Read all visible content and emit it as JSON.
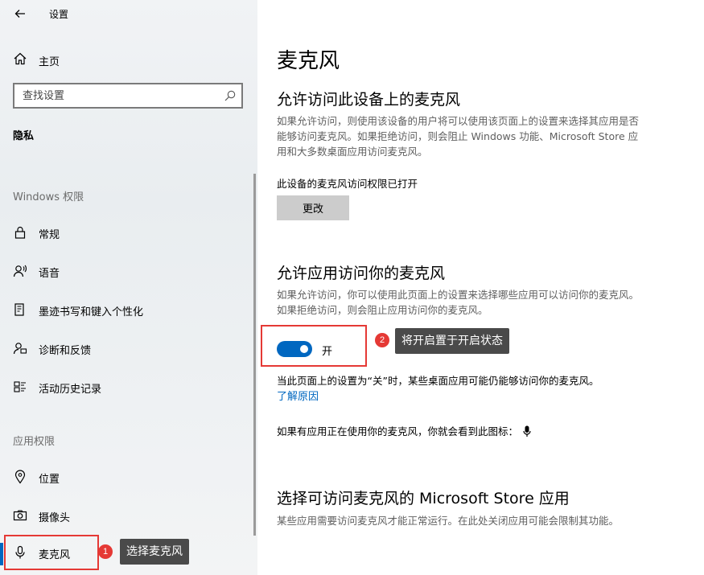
{
  "sidebar": {
    "title": "设置",
    "home_label": "主页",
    "search_placeholder": "查找设置",
    "section_title": "隐私",
    "group_windows": "Windows 权限",
    "windows_items": [
      {
        "label": "常规",
        "icon": "lock-icon"
      },
      {
        "label": "语音",
        "icon": "speech-icon"
      },
      {
        "label": "墨迹书写和键入个性化",
        "icon": "ink-typing-icon"
      },
      {
        "label": "诊断和反馈",
        "icon": "feedback-icon"
      },
      {
        "label": "活动历史记录",
        "icon": "activity-history-icon"
      }
    ],
    "group_app": "应用权限",
    "app_items": [
      {
        "label": "位置",
        "icon": "location-icon"
      },
      {
        "label": "摄像头",
        "icon": "camera-icon"
      },
      {
        "label": "麦克风",
        "icon": "microphone-icon",
        "active": true
      }
    ]
  },
  "annotations": {
    "step1_number": "1",
    "step1_text": "选择麦克风",
    "step2_number": "2",
    "step2_text": "将开启置于开启状态",
    "highlight_color": "#e53935"
  },
  "main": {
    "page_title": "麦克风",
    "device_section": {
      "heading": "允许访问此设备上的麦克风",
      "description": "如果允许访问，则使用该设备的用户将可以使用该页面上的设置来选择其应用是否能够访问麦克风。如果拒绝访问，则会阻止 Windows 功能、Microsoft Store 应用和大多数桌面应用访问麦克风。",
      "status": "此设备的麦克风访问权限已打开",
      "change_button": "更改"
    },
    "app_section": {
      "heading": "允许应用访问你的麦克风",
      "description": "如果允许访问，你可以使用此页面上的设置来选择哪些应用可以访问你的麦克风。如果拒绝访问，则会阻止应用访问你的麦克风。",
      "toggle_state": "开",
      "toggle_on": true,
      "note": "当此页面上的设置为“关”时，某些桌面应用可能仍能够访问你的麦克风。",
      "learn_more": "了解原因",
      "icon_hint": "如果有应用正在使用你的麦克风，你就会看到此图标："
    },
    "store_section": {
      "heading": "选择可访问麦克风的 Microsoft Store 应用",
      "description": "某些应用需要访问麦克风才能正常运行。在此处关闭应用可能会限制其功能。"
    }
  },
  "colors": {
    "accent": "#0067c0",
    "sidebar_bg": "#eceff2",
    "button_bg": "#cccccc",
    "tooltip_bg": "#4a4a4a"
  }
}
